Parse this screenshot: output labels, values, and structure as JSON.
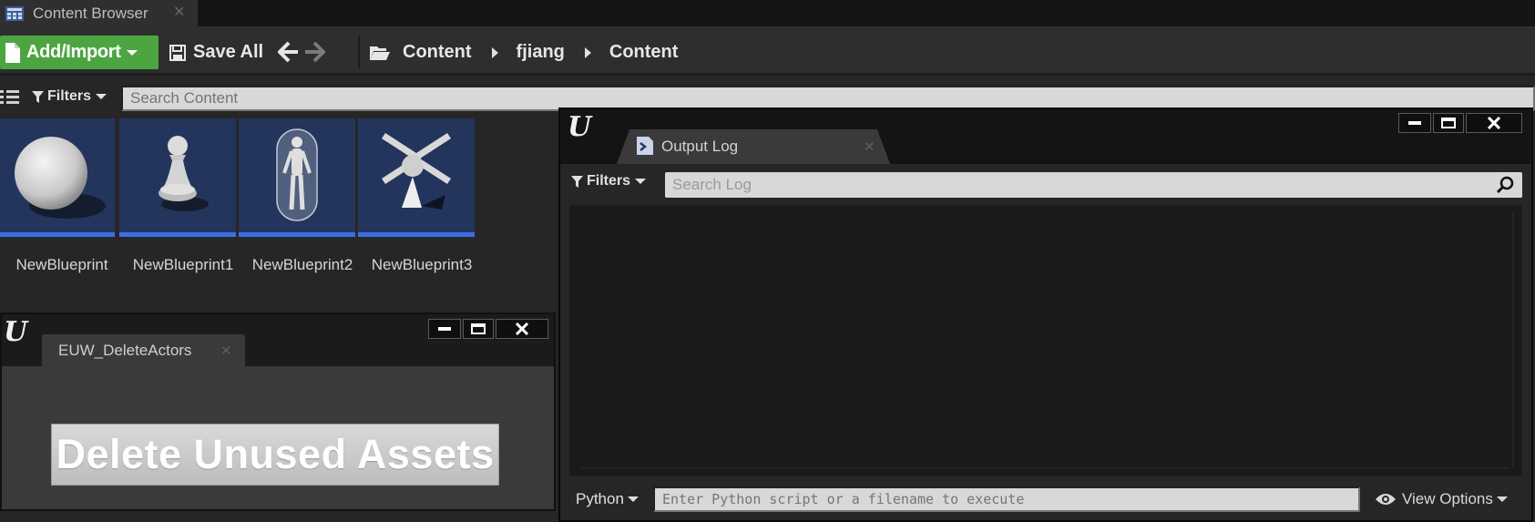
{
  "content_browser": {
    "tab_title": "Content Browser",
    "tab_close": "✕",
    "toolbar": {
      "add_import_label": "Add/Import",
      "save_all_label": "Save All"
    },
    "breadcrumbs": [
      "Content",
      "fjiang",
      "Content"
    ],
    "filters_label": "Filters",
    "search_placeholder": "Search Content",
    "assets": [
      {
        "name": "NewBlueprint",
        "thumbnail": "sphere"
      },
      {
        "name": "NewBlueprint1",
        "thumbnail": "pawn"
      },
      {
        "name": "NewBlueprint2",
        "thumbnail": "character"
      },
      {
        "name": "NewBlueprint3",
        "thumbnail": "default-pawn"
      }
    ]
  },
  "euw_window": {
    "tab_title": "EUW_DeleteActors",
    "tab_close": "✕",
    "button_label": "Delete Unused Assets"
  },
  "output_log": {
    "tab_title": "Output Log",
    "tab_close": "✕",
    "filters_label": "Filters",
    "search_placeholder": "Search Log",
    "command_type": "Python",
    "command_placeholder": "Enter Python script or a filename to execute",
    "view_options_label": "View Options"
  },
  "colors": {
    "add_button_green": "#4da542",
    "asset_underline_blue": "#3b6ee6",
    "thumbnail_bg": "#23355c"
  }
}
